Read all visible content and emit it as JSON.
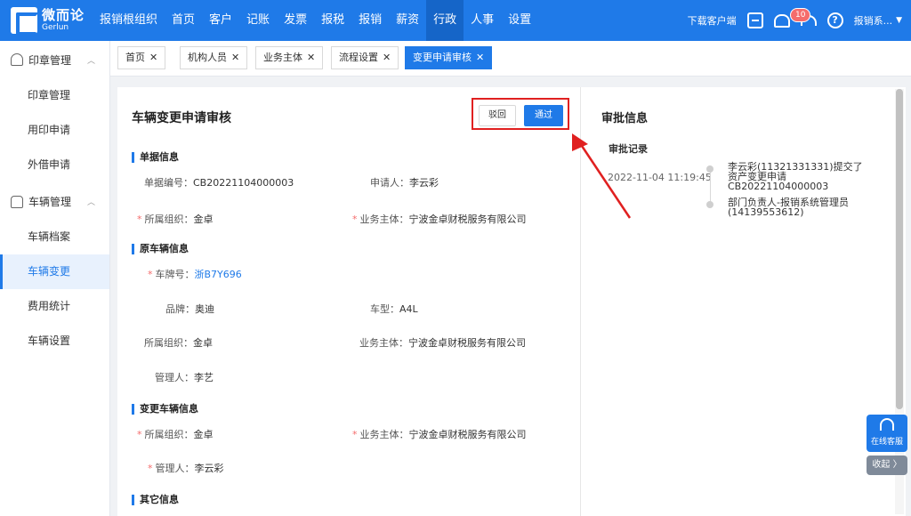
{
  "app": {
    "logo_cn": "微而论",
    "logo_en": "Gerlun"
  },
  "nav": {
    "items": [
      {
        "label": "报销根组织"
      },
      {
        "label": "首页"
      },
      {
        "label": "客户"
      },
      {
        "label": "记账"
      },
      {
        "label": "发票"
      },
      {
        "label": "报税"
      },
      {
        "label": "报销"
      },
      {
        "label": "薪资"
      },
      {
        "label": "行政"
      },
      {
        "label": "人事"
      },
      {
        "label": "设置"
      }
    ],
    "active": "行政",
    "download_label": "下载客户端",
    "notification_count": "10",
    "user_name": "报销系..."
  },
  "sidebar": {
    "groups": [
      {
        "label": "印章管理",
        "icon": "stamp-icon",
        "items": [
          {
            "label": "印章管理"
          },
          {
            "label": "用印申请"
          },
          {
            "label": "外借申请"
          }
        ]
      },
      {
        "label": "车辆管理",
        "icon": "car-icon",
        "items": [
          {
            "label": "车辆档案"
          },
          {
            "label": "车辆变更"
          },
          {
            "label": "费用统计"
          },
          {
            "label": "车辆设置"
          }
        ]
      }
    ],
    "active_item": "车辆变更"
  },
  "tabs": [
    {
      "label": "首页"
    },
    {
      "label": "机构人员"
    },
    {
      "label": "业务主体"
    },
    {
      "label": "流程设置"
    },
    {
      "label": "变更申请审核"
    }
  ],
  "form": {
    "title": "车辆变更申请审核",
    "reject_label": "驳回",
    "pass_label": "通过",
    "sections": {
      "doc_info": "单据信息",
      "orig_vehicle": "原车辆信息",
      "change_vehicle": "变更车辆信息",
      "other_info": "其它信息"
    },
    "doc": {
      "no_label": "单据编号：",
      "no_value": "CB20221104000003",
      "applicant_label": "申请人：",
      "applicant_value": "李云彩",
      "org_label": "所属组织：",
      "org_value": "金卓",
      "entity_label": "业务主体：",
      "entity_value": "宁波金卓财税服务有限公司"
    },
    "orig": {
      "plate_label": "车牌号：",
      "plate_value": "浙B7Y696",
      "brand_label": "品牌：",
      "brand_value": "奥迪",
      "model_label": "车型：",
      "model_value": "A4L",
      "org_label": "所属组织：",
      "org_value": "金卓",
      "entity_label": "业务主体：",
      "entity_value": "宁波金卓财税服务有限公司",
      "manager_label": "管理人：",
      "manager_value": "李艺"
    },
    "change": {
      "org_label": "所属组织：",
      "org_value": "金卓",
      "entity_label": "业务主体：",
      "entity_value": "宁波金卓财税服务有限公司",
      "manager_label": "管理人：",
      "manager_value": "李云彩"
    }
  },
  "approval": {
    "title": "审批信息",
    "record_title": "审批记录",
    "time": "2022-11-04 11:19:45",
    "entry1": "李云彩(11321331331)提交了资产变更申请CB20221104000003",
    "entry2": "部门负责人-报销系统管理员(14139553612)"
  },
  "service": {
    "label": "在线客服",
    "collapse_label": "收起 〉"
  },
  "colors": {
    "brand": "#1f7ae8",
    "highlight": "#e02020"
  }
}
